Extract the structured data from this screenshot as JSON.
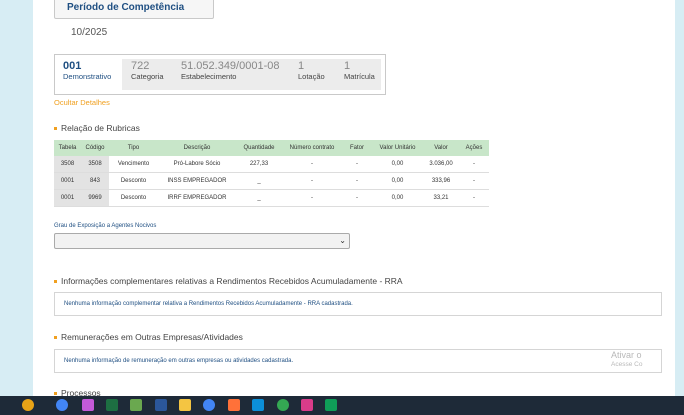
{
  "periodo": {
    "label": "Período de Competência",
    "value": "10/2025"
  },
  "demonstrativo": {
    "numero": "001",
    "numero_label": "Demonstrativo",
    "categoria": "722",
    "categoria_label": "Categoria",
    "estabelecimento": "51.052.349/0001-08",
    "estabelecimento_label": "Estabelecimento",
    "lotacao": "1",
    "lotacao_label": "Lotação",
    "matricula": "1",
    "matricula_label": "Matrícula"
  },
  "ocultar_link": "Ocultar Detalhes",
  "rubricas": {
    "title": "Relação de Rubricas",
    "headers": [
      "Tabela",
      "Código",
      "Tipo",
      "Descrição",
      "Quantidade",
      "Número contrato",
      "Fator",
      "Valor Unitário",
      "Valor",
      "Ações"
    ],
    "rows": [
      [
        "3508",
        "3508",
        "Vencimento",
        "Pró-Labore Sócio",
        "227,33",
        "-",
        "-",
        "0,00",
        "3.036,00",
        "-"
      ],
      [
        "0001",
        "843",
        "Desconto",
        "INSS EMPREGADOR",
        "_",
        "-",
        "-",
        "0,00",
        "333,96",
        "-"
      ],
      [
        "0001",
        "9969",
        "Desconto",
        "IRRF EMPREGADOR",
        "_",
        "-",
        "-",
        "0,00",
        "33,21",
        "-"
      ]
    ]
  },
  "grau": {
    "label": "Grau de Exposição a Agentes Nocivos",
    "selected": ""
  },
  "rra": {
    "title": "Informações complementares relativas a Rendimentos Recebidos Acumuladamente - RRA",
    "message": "Nenhuma informação complementar relativa a Rendimentos Recebidos Acumuladamente - RRA cadastrada."
  },
  "outras": {
    "title": "Remunerações em Outras Empresas/Atividades",
    "message": "Nenhuma informação de remuneração em outras empresas ou atividades cadastrada."
  },
  "processos": {
    "title": "Processos"
  },
  "watermark": {
    "line1": "Ativar o",
    "line2": "Acesse Co"
  },
  "taskbar": {
    "icons": [
      {
        "name": "sun-weather-icon",
        "color": "#e8a317"
      },
      {
        "name": "chrome-icon",
        "color": "#4285f4"
      },
      {
        "name": "copilot-icon",
        "color": "#c45ad8"
      },
      {
        "name": "excel-icon",
        "color": "#1d6f42"
      },
      {
        "name": "paint-icon",
        "color": "#6aa84f"
      },
      {
        "name": "word-icon",
        "color": "#2b579a"
      },
      {
        "name": "file-explorer-icon",
        "color": "#f4c542"
      },
      {
        "name": "chrome-active-icon",
        "color": "#4285f4"
      },
      {
        "name": "firefox-icon",
        "color": "#ff7139"
      },
      {
        "name": "edge-icon",
        "color": "#0c8fd8"
      },
      {
        "name": "chrome-alt-icon",
        "color": "#34a853"
      },
      {
        "name": "app-pink-icon",
        "color": "#d93c8a"
      },
      {
        "name": "sheets-icon",
        "color": "#0f9d58"
      }
    ]
  }
}
